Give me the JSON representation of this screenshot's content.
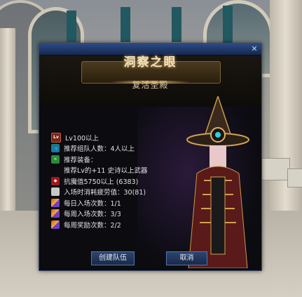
{
  "dialog": {
    "title": "洞察之眼",
    "subtitle": "复活圣殿",
    "close_icon": "close-icon"
  },
  "requirements": [
    {
      "icon": "level-icon",
      "icon_text": "Lv",
      "text": "Lv100以上"
    },
    {
      "icon": "party-icon",
      "text": "推荐组队人数：4人以上"
    },
    {
      "icon": "equipment-icon",
      "text": "推荐装备："
    },
    {
      "icon": "",
      "text": "推荐Lv的+11 史诗以上武器"
    },
    {
      "icon": "shield-icon",
      "text": "抗魔值5750以上 (6383)"
    },
    {
      "icon": "fatigue-icon",
      "text": "入场时消耗疲劳值：30(81)"
    },
    {
      "icon": "ticket-icon",
      "text": "每日入场次数：1/1"
    },
    {
      "icon": "ticket-icon",
      "text": "每周入场次数：3/3"
    },
    {
      "icon": "ticket-icon",
      "text": "每周奖励次数：2/2"
    }
  ],
  "buttons": {
    "create_party": "创建队伍",
    "cancel": "取消"
  }
}
